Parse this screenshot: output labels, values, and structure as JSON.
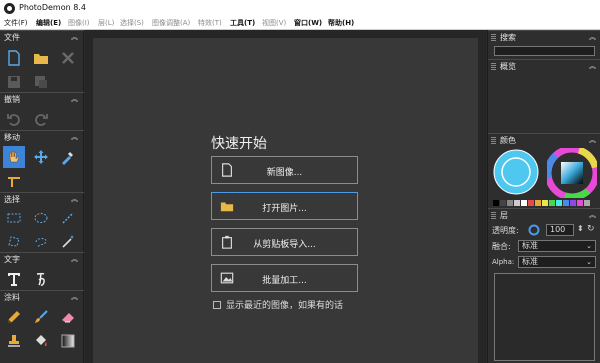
{
  "window": {
    "title": "PhotoDemon 8.4"
  },
  "menu": [
    {
      "label": "文件(F)",
      "style": "normal"
    },
    {
      "label": "编辑(E)",
      "style": "bold"
    },
    {
      "label": "图像(I)",
      "style": "dim"
    },
    {
      "label": "层(L)",
      "style": "dim"
    },
    {
      "label": "选择(S)",
      "style": "dim"
    },
    {
      "label": "图像调整(A)",
      "style": "dim"
    },
    {
      "label": "特效(T)",
      "style": "dim"
    },
    {
      "label": "工具(T)",
      "style": "bold"
    },
    {
      "label": "视图(V)",
      "style": "dim"
    },
    {
      "label": "窗口(W)",
      "style": "bold"
    },
    {
      "label": "帮助(H)",
      "style": "bold"
    }
  ],
  "left_panel": {
    "sections": {
      "file": "文件",
      "undo": "撤销",
      "move": "移动",
      "select": "选择",
      "text": "文字",
      "paint": "涂料"
    }
  },
  "quick_start": {
    "title": "快速开始",
    "buttons": {
      "new_image": "新图像...",
      "open_image": "打开图片...",
      "import_clipboard": "从剪贴板导入...",
      "batch": "批量加工..."
    },
    "recent_checkbox": "显示最近的图像，如果有的话"
  },
  "right_panel": {
    "search_header": "搜索",
    "overview_header": "概览",
    "color_header": "颜色",
    "layers_header": "层",
    "opacity_label": "透明度:",
    "opacity_value": "100",
    "blend_label": "融合:",
    "blend_value": "标准",
    "alpha_label": "Alpha:",
    "alpha_value": "标准",
    "primary_color": "#4fc8f0"
  },
  "chevron": "︾"
}
